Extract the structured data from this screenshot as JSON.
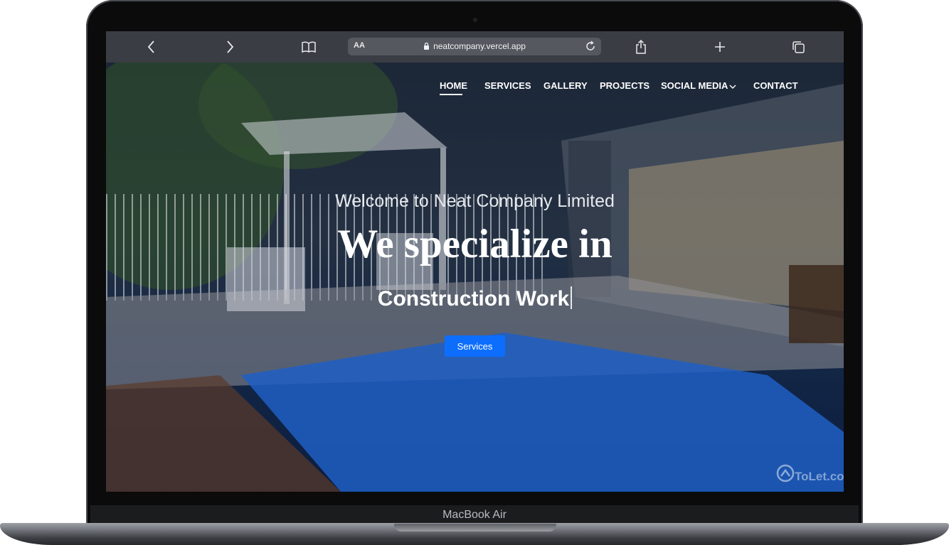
{
  "browser": {
    "aa_label": "AA",
    "url": "neatcompany.vercel.app"
  },
  "nav": {
    "items": [
      {
        "label": "HOME"
      },
      {
        "label": "SERVICES"
      },
      {
        "label": "GALLERY"
      },
      {
        "label": "PROJECTS"
      },
      {
        "label": "SOCIAL MEDIA"
      },
      {
        "label": "CONTACT"
      }
    ]
  },
  "hero": {
    "welcome": "Welcome to Neat Company Limited",
    "headline": "We specialize in",
    "typed_text": "Construction Work",
    "button_label": "Services",
    "watermark": "ToLet.co"
  },
  "device": {
    "model": "MacBook Air"
  },
  "colors": {
    "button": "#0d6efd",
    "toolbar": "#3a3d43"
  }
}
